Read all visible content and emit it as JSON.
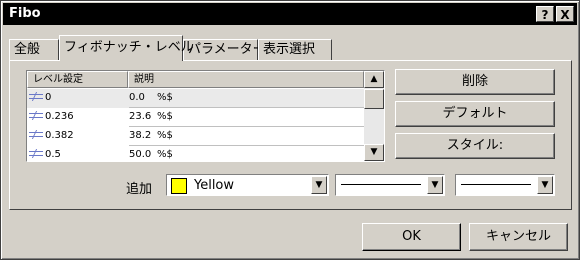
{
  "window": {
    "title": "Fibo",
    "help_label": "?",
    "close_label": "X"
  },
  "tabs": [
    {
      "label": "全般"
    },
    {
      "label": "フィボナッチ・レベル"
    },
    {
      "label": "パラメーター"
    },
    {
      "label": "表示選択"
    }
  ],
  "levels_table": {
    "columns": [
      "レベル設定",
      "説明"
    ],
    "rows": [
      {
        "level": "0",
        "desc": "0.0",
        "suffix": "%$"
      },
      {
        "level": "0.236",
        "desc": "23.6",
        "suffix": "%$"
      },
      {
        "level": "0.382",
        "desc": "38.2",
        "suffix": "%$"
      },
      {
        "level": "0.5",
        "desc": "50.0",
        "suffix": "%$"
      }
    ]
  },
  "side_buttons": {
    "delete": "削除",
    "default": "デフォルト",
    "style": "スタイル:"
  },
  "add_row": {
    "label": "追加",
    "color_name": "Yellow",
    "color_hex": "#ffff00"
  },
  "footer": {
    "ok": "OK",
    "cancel": "キャンセル"
  }
}
